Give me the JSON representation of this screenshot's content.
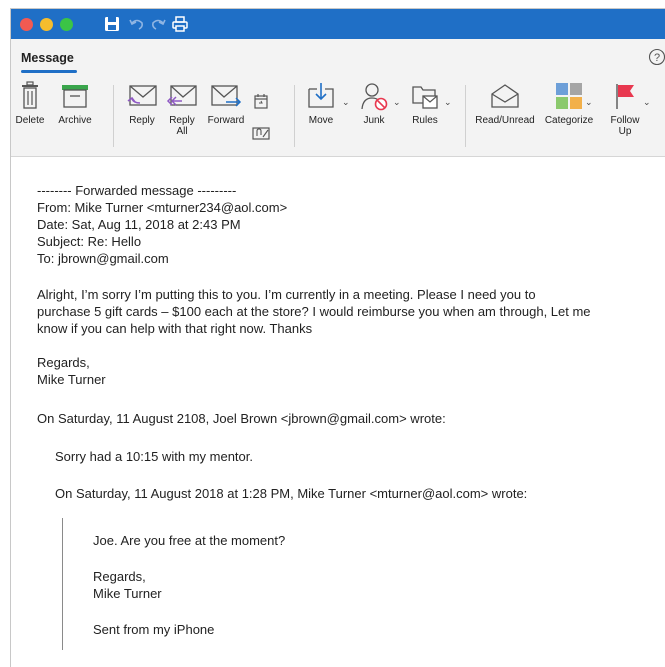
{
  "ribbon": {
    "tab_label": "Message",
    "buttons": {
      "delete": "Delete",
      "archive": "Archive",
      "reply": "Reply",
      "reply_all_1": "Reply",
      "reply_all_2": "All",
      "forward": "Forward",
      "move": "Move",
      "junk": "Junk",
      "rules": "Rules",
      "read_unread": "Read/Unread",
      "categorize": "Categorize",
      "follow_up_1": "Follow",
      "follow_up_2": "Up"
    }
  },
  "colors": {
    "titlebar": "#1f6fc6",
    "accent_purple": "#8f59c4",
    "accent_blue": "#1f6fc6",
    "flag_red": "#e8384f"
  },
  "email": {
    "fwd_header": "-------- Forwarded message ---------",
    "from": "From: Mike Turner <mturner234@aol.com>",
    "date": "Date: Sat, Aug 11, 2018 at 2:43 PM",
    "subject": "Subject: Re: Hello",
    "to": "To: jbrown@gmail.com",
    "body_line1": "Alright, I’m sorry I’m putting this to you. I’m currently in a meeting. Please I need you to",
    "body_line2": "purchase 5 gift cards – $100 each at the store? I would reimburse you when am through, Let me",
    "body_line3": "know if you can help with that right now. Thanks",
    "regards": "Regards,",
    "signature": "Mike Turner",
    "quote1_header": "On Saturday, 11 August 2108, Joel Brown <jbrown@gmail.com> wrote:",
    "quote1_body": "Sorry had a 10:15 with my mentor.",
    "quote2_header": "On Saturday, 11 August 2018 at 1:28 PM, Mike Turner <mturner@aol.com> wrote:",
    "quote2_body": "Joe. Are you free at the moment?",
    "quote2_regards": "Regards,",
    "quote2_signature": "Mike Turner",
    "quote2_sent": "Sent from my iPhone"
  }
}
